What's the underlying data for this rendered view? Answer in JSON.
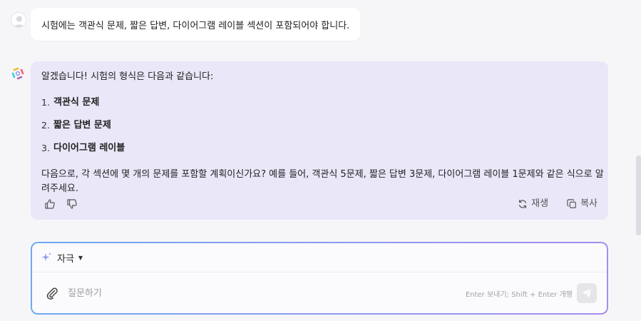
{
  "user_message": {
    "text": "시험에는 객관식 문제, 짧은 답변, 다이어그램 레이블 섹션이 포함되어야 합니다."
  },
  "ai_message": {
    "intro": "알겠습니다! 시험의 형식은 다음과 같습니다:",
    "list": [
      {
        "num": "1.",
        "text": "객관식 문제"
      },
      {
        "num": "2.",
        "text": "짧은 답변 문제"
      },
      {
        "num": "3.",
        "text": "다이어그램 레이블"
      }
    ],
    "outro": "다음으로, 각 섹션에 몇 개의 문제를 포함할 계획이신가요? 예를 들어, 객관식 5문제, 짧은 답변 3문제, 다이어그램 레이블 1문제와 같은 식으로 알려주세요.",
    "actions": {
      "regenerate_label": "재생",
      "copy_label": "복사"
    }
  },
  "composer": {
    "mode_label": "자극",
    "placeholder": "질문하기",
    "hint": "Enter 보내기; Shift + Enter 개행"
  },
  "icons": {
    "user_avatar": "user-avatar-icon",
    "ai_avatar": "ai-logo-icon",
    "like": "thumbs-up-icon",
    "dislike": "thumbs-down-icon",
    "regenerate": "refresh-icon",
    "copy": "copy-icon",
    "mode": "sparkle-icon",
    "attach": "paperclip-icon",
    "send": "send-icon"
  },
  "colors": {
    "page_bg": "#f6f6f9",
    "ai_bubble_bg": "#e9e7f8",
    "user_bubble_bg": "#ffffff",
    "composer_border_start": "#6fa8f3",
    "composer_border_end": "#a68cf0"
  }
}
